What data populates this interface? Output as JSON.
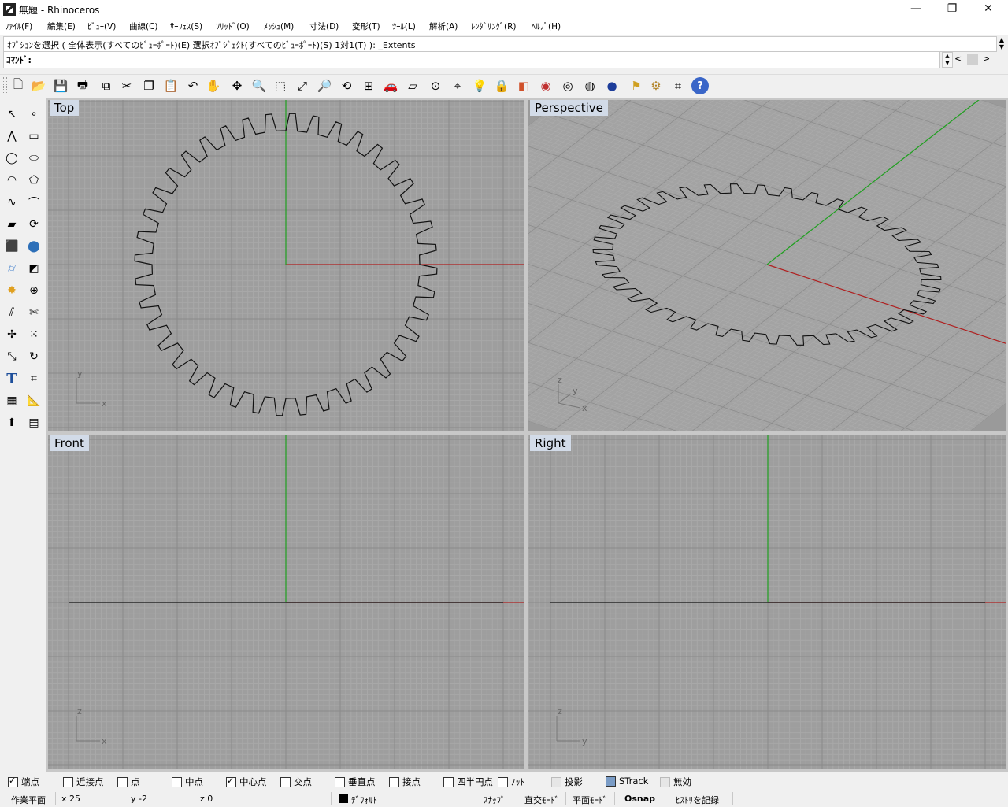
{
  "window": {
    "title": "無題 - Rhinoceros",
    "minimize": "—",
    "restore": "❐",
    "close": "✕"
  },
  "menu": [
    {
      "label": "ﾌｧｲﾙ(F)"
    },
    {
      "label": "編集(E)"
    },
    {
      "label": "ﾋﾞｭｰ(V)"
    },
    {
      "label": "曲線(C)"
    },
    {
      "label": "ｻｰﾌｪｽ(S)"
    },
    {
      "label": "ｿﾘｯﾄﾞ(O)"
    },
    {
      "label": "ﾒｯｼｭ(M)"
    },
    {
      "label": "寸法(D)"
    },
    {
      "label": "変形(T)"
    },
    {
      "label": "ﾂｰﾙ(L)"
    },
    {
      "label": "解析(A)"
    },
    {
      "label": "ﾚﾝﾀﾞﾘﾝｸﾞ(R)"
    },
    {
      "label": "ﾍﾙﾌﾟ(H)"
    }
  ],
  "command": {
    "history": "ｵﾌﾟｼｮﾝを選択 ( 全体表示(すべてのﾋﾞｭｰﾎﾟｰﾄ)(E)  選択ｵﾌﾞｼﾞｪｸﾄ(すべてのﾋﾞｭｰﾎﾟｰﾄ)(S)  1対1(T) ): _Extents",
    "prompt": "ｺﾏﾝﾄﾞ:",
    "value": ""
  },
  "toolbar": {
    "icons": [
      "new-file-icon",
      "open-icon",
      "save-icon",
      "print-icon",
      "import-icon",
      "cut-icon",
      "copy-icon",
      "paste-icon",
      "undo-icon",
      "pan-hand-icon",
      "rotate-view-icon",
      "zoom-icon",
      "zoom-window-icon",
      "zoom-extents-icon",
      "zoom-selected-icon",
      "undo-view-icon",
      "four-viewports-icon",
      "car-icon",
      "plane-icon",
      "cplane-icon",
      "osnap-icon",
      "lightbulb-icon",
      "lock-icon",
      "layer-icon",
      "color-wheel-icon",
      "wireframe-icon",
      "shaded-sphere-icon",
      "render-sphere-icon",
      "render-tools-icon",
      "gear-icon",
      "dimension-icon",
      "help-icon"
    ]
  },
  "left_toolbar": {
    "icons": [
      "select-arrow-icon",
      "point-icon",
      "polyline-icon",
      "rectangle-icon",
      "circle-icon",
      "ellipse-icon",
      "arc-icon",
      "polygon-icon",
      "free-curve-icon",
      "fillet-curve-icon",
      "surface-icon",
      "revolve-icon",
      "box-icon",
      "sphere-icon",
      "cylinder-icon",
      "surface-edit-icon",
      "explode-icon",
      "boolean-icon",
      "split-icon",
      "trim-icon",
      "move-icon",
      "array-icon",
      "scale-icon",
      "rotate-icon",
      "text-icon",
      "dimension-icon",
      "block-icon",
      "measure-icon",
      "extrude-icon",
      "grid-icon"
    ]
  },
  "viewports": {
    "top": {
      "label": "Top",
      "axis_x": "x",
      "axis_y": "y"
    },
    "perspective": {
      "label": "Perspective",
      "axis_x": "x",
      "axis_y": "y",
      "axis_z": "z"
    },
    "front": {
      "label": "Front",
      "axis_x": "x",
      "axis_z": "z"
    },
    "right": {
      "label": "Right",
      "axis_y": "y",
      "axis_z": "z"
    }
  },
  "gear": {
    "teeth": 40
  },
  "osnap": [
    {
      "label": "端点",
      "state": "checked"
    },
    {
      "label": "近接点",
      "state": "unchecked"
    },
    {
      "label": "点",
      "state": "unchecked"
    },
    {
      "label": "中点",
      "state": "unchecked"
    },
    {
      "label": "中心点",
      "state": "checked"
    },
    {
      "label": "交点",
      "state": "unchecked"
    },
    {
      "label": "垂直点",
      "state": "unchecked"
    },
    {
      "label": "接点",
      "state": "unchecked"
    },
    {
      "label": "四半円点",
      "state": "unchecked"
    },
    {
      "label": "ﾉｯﾄ",
      "state": "unchecked"
    },
    {
      "label": "投影",
      "state": "grey"
    },
    {
      "label": "STrack",
      "state": "blue"
    },
    {
      "label": "無効",
      "state": "grey"
    }
  ],
  "status": {
    "cplane": "作業平面",
    "x": "x 25",
    "y": "y -2",
    "z": "z 0",
    "layer": "ﾃﾞﾌｫﾙﾄ",
    "snap": "ｽﾅｯﾌﾟ",
    "ortho": "直交ﾓｰﾄﾞ",
    "planar": "平面ﾓｰﾄﾞ",
    "osnap": "Osnap",
    "history": "ﾋｽﾄﾘを記録"
  },
  "colors": {
    "viewport_bg": "#9e9e9e",
    "grid_minor": "#a8a8a8",
    "grid_major": "#8a8a8a",
    "x_axis": "#b02020",
    "y_axis": "#20a020",
    "label_bg": "#d2dbe8"
  }
}
